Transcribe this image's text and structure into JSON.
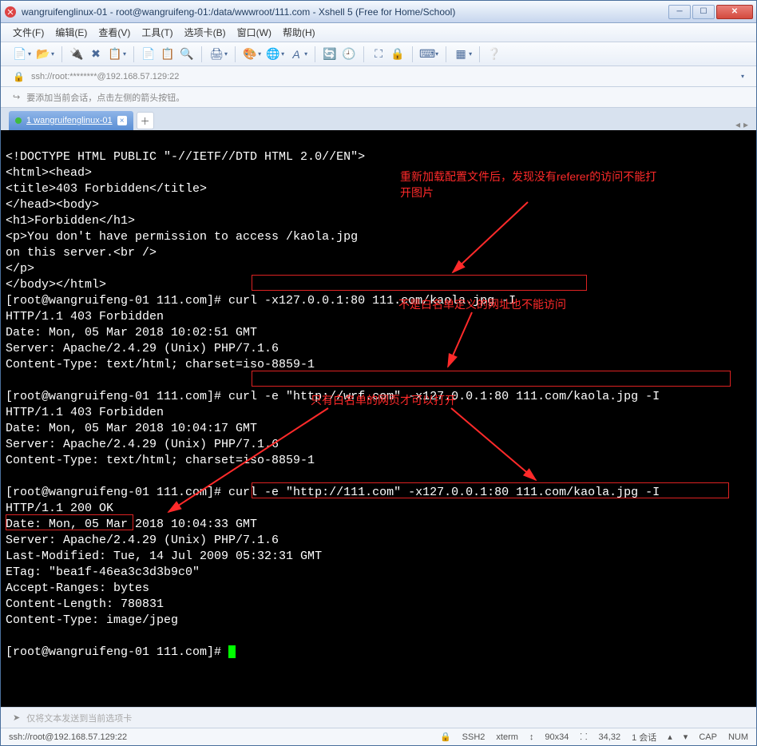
{
  "window": {
    "title": "wangruifenglinux-01 - root@wangruifeng-01:/data/wwwroot/111.com - Xshell 5 (Free for Home/School)"
  },
  "menu": {
    "file": "文件(F)",
    "edit": "编辑(E)",
    "view": "查看(V)",
    "tools": "工具(T)",
    "tabs": "选项卡(B)",
    "window": "窗口(W)",
    "help": "帮助(H)"
  },
  "address": {
    "lock": "🔒",
    "text": "ssh://root:********@192.168.57.129:22"
  },
  "tip": {
    "text": "要添加当前会话，点击左侧的箭头按钮。"
  },
  "tab": {
    "title": "1 wangruifenglinux-01"
  },
  "terminal_lines": [
    "<!DOCTYPE HTML PUBLIC \"-//IETF//DTD HTML 2.0//EN\">",
    "<html><head>",
    "<title>403 Forbidden</title>",
    "</head><body>",
    "<h1>Forbidden</h1>",
    "<p>You don't have permission to access /kaola.jpg",
    "on this server.<br />",
    "</p>",
    "</body></html>",
    "[root@wangruifeng-01 111.com]# curl -x127.0.0.1:80 111.com/kaola.jpg -I",
    "HTTP/1.1 403 Forbidden",
    "Date: Mon, 05 Mar 2018 10:02:51 GMT",
    "Server: Apache/2.4.29 (Unix) PHP/7.1.6",
    "Content-Type: text/html; charset=iso-8859-1",
    "",
    "[root@wangruifeng-01 111.com]# curl -e \"http://wrf.com\" -x127.0.0.1:80 111.com/kaola.jpg -I",
    "HTTP/1.1 403 Forbidden",
    "Date: Mon, 05 Mar 2018 10:04:17 GMT",
    "Server: Apache/2.4.29 (Unix) PHP/7.1.6",
    "Content-Type: text/html; charset=iso-8859-1",
    "",
    "[root@wangruifeng-01 111.com]# curl -e \"http://111.com\" -x127.0.0.1:80 111.com/kaola.jpg -I",
    "HTTP/1.1 200 OK",
    "Date: Mon, 05 Mar 2018 10:04:33 GMT",
    "Server: Apache/2.4.29 (Unix) PHP/7.1.6",
    "Last-Modified: Tue, 14 Jul 2009 05:32:31 GMT",
    "ETag: \"bea1f-46ea3c3d3b9c0\"",
    "Accept-Ranges: bytes",
    "Content-Length: 780831",
    "Content-Type: image/jpeg",
    "",
    "[root@wangruifeng-01 111.com]# "
  ],
  "annotations": {
    "a1": "重新加载配置文件后，发现没有referer的访问不能打开图片",
    "a2": "不是白名单定义的网址也不能访问",
    "a3": "只有白名单的网页才可以打开"
  },
  "sendbar": {
    "placeholder": "仅将文本发送到当前选项卡"
  },
  "status": {
    "addr": "ssh://root@192.168.57.129:22",
    "proto": "SSH2",
    "term": "xterm",
    "size": "90x34",
    "pos": "34,32",
    "sess": "1 会话",
    "cap": "CAP",
    "num": "NUM"
  }
}
